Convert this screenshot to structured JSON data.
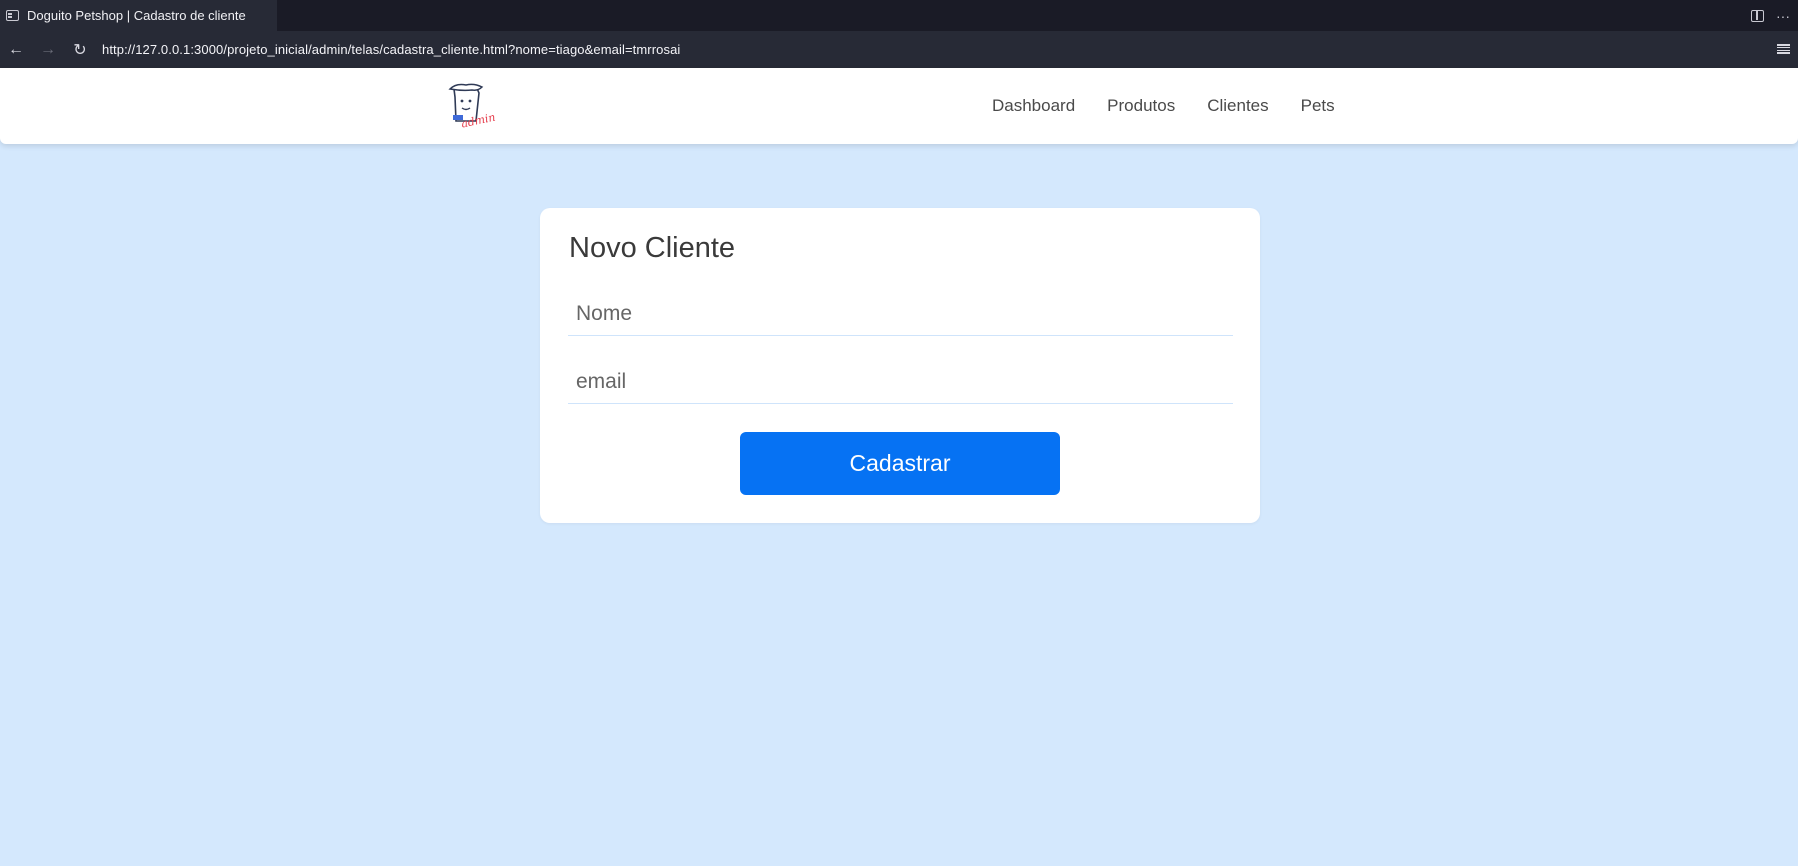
{
  "browser": {
    "tab_title": "Doguito Petshop | Cadastro de cliente",
    "url": "http://127.0.0.1:3000/projeto_inicial/admin/telas/cadastra_cliente.html?nome=tiago&email=tmrrosai",
    "more_label": "···",
    "back_label": "←",
    "forward_label": "→",
    "reload_label": "↻"
  },
  "header": {
    "logo_text": "admin",
    "nav": [
      {
        "label": "Dashboard"
      },
      {
        "label": "Produtos"
      },
      {
        "label": "Clientes"
      },
      {
        "label": "Pets"
      }
    ]
  },
  "form": {
    "title": "Novo Cliente",
    "name_placeholder": "Nome",
    "email_placeholder": "email",
    "submit_label": "Cadastrar"
  },
  "colors": {
    "page_background": "#d4e8fd",
    "primary_button": "#0672f3",
    "logo_accent": "#e53b4a",
    "logo_blue": "#3f6ad8"
  }
}
